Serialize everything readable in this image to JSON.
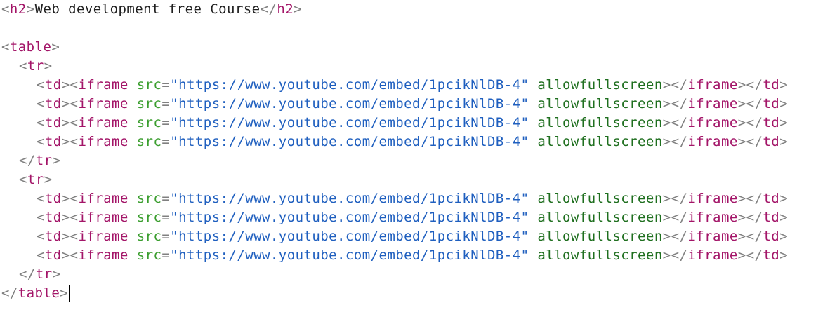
{
  "code": {
    "h2_tag": "h2",
    "h2_text": "Web development free Course",
    "table_tag": "table",
    "tr_tag": "tr",
    "td_tag": "td",
    "iframe_tag": "iframe",
    "src_attr": "src",
    "src_value": "\"https://www.youtube.com/embed/1pcikNlDB-4\"",
    "allowfullscreen_attr": "allowfullscreen"
  },
  "syntax_colors": {
    "bracket": "#808080",
    "tag": "#a31568",
    "attribute": "#3b9e2f",
    "bare_attribute": "#1f6f1f",
    "string": "#1f5fbf",
    "text": "#1f1f1f",
    "background": "#ffffff"
  }
}
